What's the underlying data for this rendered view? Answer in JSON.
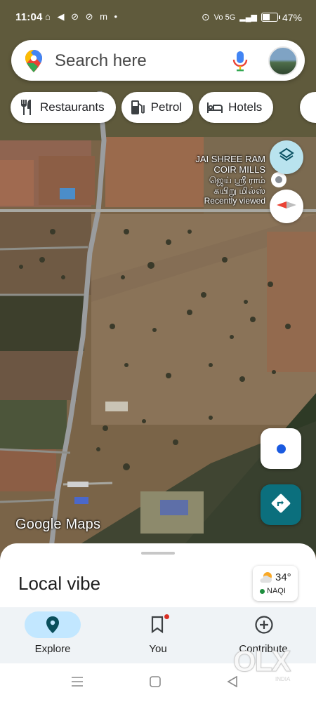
{
  "status_bar": {
    "time": "11:04",
    "left_icons": "⌂ ◀ ⊘ ⊘ m •",
    "network_label": "Vo 5G",
    "battery_percent": "47%",
    "battery_level": 0.47
  },
  "search": {
    "placeholder": "Search here"
  },
  "chips": [
    {
      "label": "Restaurants",
      "icon": "restaurant-icon"
    },
    {
      "label": "Petrol",
      "icon": "gas-station-icon"
    },
    {
      "label": "Hotels",
      "icon": "hotel-icon"
    }
  ],
  "map": {
    "poi_lines": [
      "JAI SHREE RAM",
      "COIR MILLS",
      "ஜெய் ஸ்ரீ ராம்",
      "கயிறு மில்ஸ்"
    ],
    "poi_subtitle": "Recently viewed",
    "attribution": "Google Maps"
  },
  "sheet": {
    "title": "Local vibe",
    "weather_temp": "34°",
    "weather_aqi": "NAQI"
  },
  "bottom_nav": {
    "items": [
      {
        "label": "Explore",
        "icon": "explore-pin-icon",
        "active": true
      },
      {
        "label": "You",
        "icon": "bookmark-icon",
        "active": false
      },
      {
        "label": "Contribute",
        "icon": "plus-circle-icon",
        "active": false
      }
    ]
  },
  "watermark": {
    "brand": "OLX",
    "sub": "INDIA"
  },
  "colors": {
    "accent": "#1a73e8",
    "directions": "#0b6f7d",
    "layers_fab": "#b9e3ee",
    "nav_active_pill": "#c2e7ff"
  }
}
